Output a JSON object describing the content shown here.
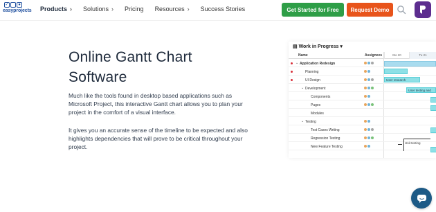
{
  "header": {
    "logo_text": "easyprojects",
    "nav": [
      {
        "label": "Products",
        "active": true,
        "chevron": true
      },
      {
        "label": "Solutions",
        "active": false,
        "chevron": true
      },
      {
        "label": "Pricing",
        "active": false,
        "chevron": false
      },
      {
        "label": "Resources",
        "active": false,
        "chevron": true
      },
      {
        "label": "Success Stories",
        "active": false,
        "chevron": false
      }
    ],
    "cta_primary": "Get Started for Free",
    "cta_secondary": "Request Demo",
    "colors": {
      "primary": "#2e9e47",
      "secondary": "#e8541b",
      "app_icon": "#5c2d8f"
    }
  },
  "hero": {
    "title_line1": "Online Gantt Chart",
    "title_line2": "Software",
    "paragraph1": "Much like the tools found in desktop based applications such as Microsoft Project, this interactive Gantt chart allows you to plan your project in the comfort of a visual interface.",
    "paragraph2": "It gives you an accurate sense of the timeline to be expected and also highlights dependencies that will prove to be critical throughout your project."
  },
  "gantt": {
    "title": "Work in Progress",
    "col_name": "Name",
    "col_assignees": "Assignees",
    "days": [
      "Mo 20",
      "Tu 21"
    ],
    "rows": [
      {
        "name": "Application Redesign",
        "indent": 1,
        "caret": "⌄",
        "dot": true,
        "bold": true
      },
      {
        "name": "Planning",
        "indent": 2,
        "caret": "",
        "dot": true,
        "bold": false
      },
      {
        "name": "UI Design",
        "indent": 2,
        "caret": "",
        "dot": true,
        "bold": false
      },
      {
        "name": "Development",
        "indent": 2,
        "caret": "⌄",
        "dot": false,
        "bold": false
      },
      {
        "name": "Components",
        "indent": 3,
        "caret": "",
        "dot": false,
        "bold": false
      },
      {
        "name": "Pages",
        "indent": 3,
        "caret": "",
        "dot": false,
        "bold": false
      },
      {
        "name": "Modules",
        "indent": 3,
        "caret": "",
        "dot": false,
        "bold": false
      },
      {
        "name": "Testing",
        "indent": 2,
        "caret": "⌄",
        "dot": false,
        "bold": false
      },
      {
        "name": "Test Cases Writing",
        "indent": 3,
        "caret": "",
        "dot": false,
        "bold": false
      },
      {
        "name": "Regression Testing",
        "indent": 3,
        "caret": "",
        "dot": false,
        "bold": false
      },
      {
        "name": "New Feature Testing",
        "indent": 3,
        "caret": "",
        "dot": false,
        "bold": false
      }
    ],
    "bar_labels": {
      "user_research": "User research",
      "user_testing": "User testing and",
      "unit_testing": "Unit testing"
    }
  }
}
